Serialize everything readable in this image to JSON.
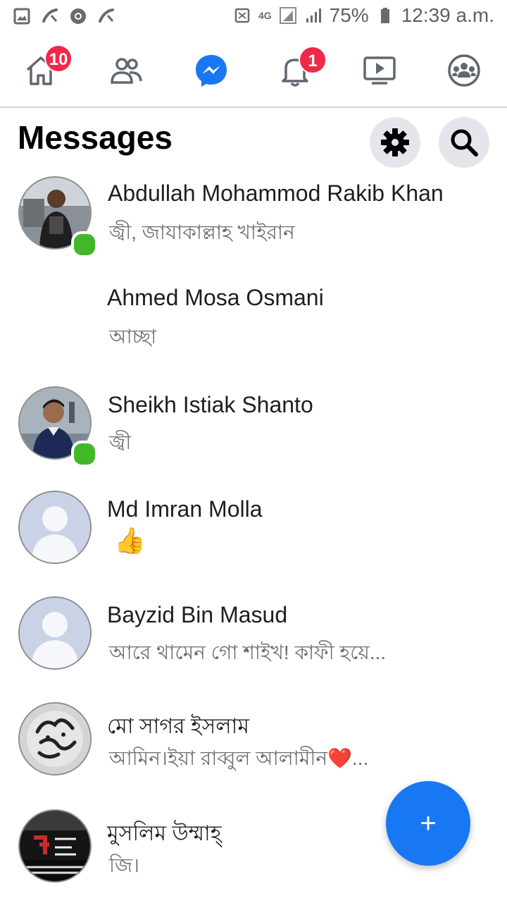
{
  "status_bar": {
    "battery": "75%",
    "time": "12:39 a.m.",
    "network": "4G",
    "icons_left": [
      "gallery-icon",
      "missed-call-icon",
      "chrome-icon",
      "missed-call-icon"
    ],
    "icons_right": [
      "screenshot-icon",
      "network-4g-icon",
      "signal-icon",
      "signal-icon",
      "battery-icon"
    ]
  },
  "nav": {
    "items": [
      {
        "name": "home",
        "icon": "home-icon",
        "badge": "10"
      },
      {
        "name": "friends",
        "icon": "friends-icon",
        "badge": ""
      },
      {
        "name": "messenger",
        "icon": "messenger-icon",
        "badge": ""
      },
      {
        "name": "notifications",
        "icon": "bell-icon",
        "badge": "1"
      },
      {
        "name": "watch",
        "icon": "video-icon",
        "badge": ""
      },
      {
        "name": "groups",
        "icon": "groups-icon",
        "badge": ""
      }
    ],
    "active": "messenger",
    "accent": "#1877f2",
    "badge_color": "#f02849"
  },
  "header": {
    "title": "Messages",
    "settings_icon": "gear-icon",
    "search_icon": "search-icon"
  },
  "conversations": [
    {
      "name": "Abdullah Mohammod Rakib Khan",
      "snippet": "জ্বী, জাযাকাল্লাহ খাইরান",
      "online": true,
      "avatar": "photo"
    },
    {
      "name": "Ahmed Mosa Osmani",
      "snippet": "আচ্ছা",
      "online": false,
      "avatar": "none"
    },
    {
      "name": "Sheikh Istiak Shanto",
      "snippet": "জ্বী",
      "online": true,
      "avatar": "photo"
    },
    {
      "name": "Md Imran Molla",
      "snippet": "👍",
      "online": false,
      "avatar": "default"
    },
    {
      "name": "Bayzid Bin Masud",
      "snippet": "আরে থামেন গো শাইখ! কাফী হয়ে...",
      "online": false,
      "avatar": "default"
    },
    {
      "name": "মো সাগর ইসলাম",
      "snippet": "আমিন।ইয়া রাব্বুল আলামীন❤️...",
      "online": false,
      "avatar": "calligraphy"
    },
    {
      "name": "মুসলিম উম্মাহ্",
      "snippet": "জি।",
      "online": false,
      "avatar": "dark"
    }
  ],
  "fab": {
    "label": "+",
    "icon": "compose-icon"
  },
  "online_color": "#42b72a"
}
